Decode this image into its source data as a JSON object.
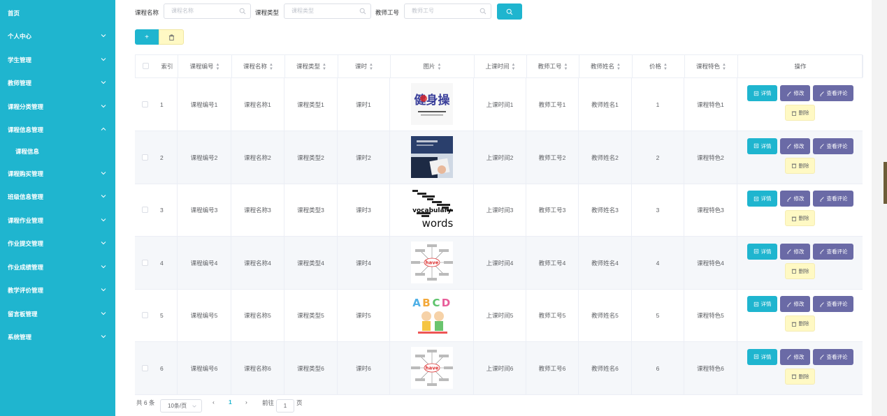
{
  "sidebar": {
    "items": [
      {
        "label": "首页",
        "expandable": false
      },
      {
        "label": "个人中心",
        "expandable": true
      },
      {
        "label": "学生管理",
        "expandable": true
      },
      {
        "label": "教师管理",
        "expandable": true
      },
      {
        "label": "课程分类管理",
        "expandable": true
      },
      {
        "label": "课程信息管理",
        "expandable": true,
        "expanded": true
      },
      {
        "label": "课程信息",
        "expandable": false,
        "sub": true
      },
      {
        "label": "课程购买管理",
        "expandable": true
      },
      {
        "label": "班级信息管理",
        "expandable": true
      },
      {
        "label": "课程作业管理",
        "expandable": true
      },
      {
        "label": "作业提交管理",
        "expandable": true
      },
      {
        "label": "作业成绩管理",
        "expandable": true
      },
      {
        "label": "教学评价管理",
        "expandable": true
      },
      {
        "label": "留言板管理",
        "expandable": true
      },
      {
        "label": "系统管理",
        "expandable": true
      }
    ]
  },
  "search": {
    "course_name_label": "课程名称",
    "course_name_placeholder": "课程名称",
    "course_type_label": "课程类型",
    "course_type_placeholder": "课程类型",
    "teacher_no_label": "教师工号",
    "teacher_no_placeholder": "教师工号"
  },
  "toolbar": {
    "add_label": "+"
  },
  "table": {
    "headers": [
      "索引",
      "课程编号",
      "课程名称",
      "课程类型",
      "课时",
      "图片",
      "上课时间",
      "教师工号",
      "教师姓名",
      "价格",
      "课程特色",
      "操作"
    ],
    "rows": [
      {
        "index": "1",
        "code": "课程编号1",
        "name": "课程名称1",
        "type": "课程类型1",
        "hours": "课时1",
        "time": "上课时间1",
        "teacher_no": "教师工号1",
        "teacher_name": "教师姓名1",
        "price": "1",
        "feature": "课程特色1",
        "image": "calligraphy"
      },
      {
        "index": "2",
        "code": "课程编号2",
        "name": "课程名称2",
        "type": "课程类型2",
        "hours": "课时2",
        "time": "上课时间2",
        "teacher_no": "教师工号2",
        "teacher_name": "教师姓名2",
        "price": "2",
        "feature": "课程特色2",
        "image": "business"
      },
      {
        "index": "3",
        "code": "课程编号3",
        "name": "课程名称3",
        "type": "课程类型3",
        "hours": "课时3",
        "time": "上课时间3",
        "teacher_no": "教师工号3",
        "teacher_name": "教师姓名3",
        "price": "3",
        "feature": "课程特色3",
        "image": "vocabulary-words"
      },
      {
        "index": "4",
        "code": "课程编号4",
        "name": "课程名称4",
        "type": "课程类型4",
        "hours": "课时4",
        "time": "上课时间4",
        "teacher_no": "教师工号4",
        "teacher_name": "教师姓名4",
        "price": "4",
        "feature": "课程特色4",
        "image": "mindmap"
      },
      {
        "index": "5",
        "code": "课程编号5",
        "name": "课程名称5",
        "type": "课程类型5",
        "hours": "课时5",
        "time": "上课时间5",
        "teacher_no": "教师工号5",
        "teacher_name": "教师姓名5",
        "price": "5",
        "feature": "课程特色5",
        "image": "abcd-kids"
      },
      {
        "index": "6",
        "code": "课程编号6",
        "name": "课程名称6",
        "type": "课程类型6",
        "hours": "课时6",
        "time": "上课时间6",
        "teacher_no": "教师工号6",
        "teacher_name": "教师姓名6",
        "price": "6",
        "feature": "课程特色6",
        "image": "mindmap"
      }
    ],
    "actions": {
      "detail": "详情",
      "edit": "修改",
      "comment": "查看评论",
      "delete": "删除"
    }
  },
  "pagination": {
    "total": "共 6 条",
    "page_size": "10条/页",
    "current_page": "1",
    "goto_label": "前往",
    "goto_value": "1",
    "page_suffix": "页"
  },
  "image_text": {
    "calligraphy": "健身操",
    "vocab": "vocabulary",
    "words": "words",
    "have": "have",
    "abcd": [
      "A",
      "B",
      "C",
      "D"
    ]
  },
  "colors": {
    "primary": "#1fb5cf",
    "edit": "#6a6aa6",
    "delete_bg": "#fff9c4",
    "row_alt": "#f5f7fa"
  }
}
